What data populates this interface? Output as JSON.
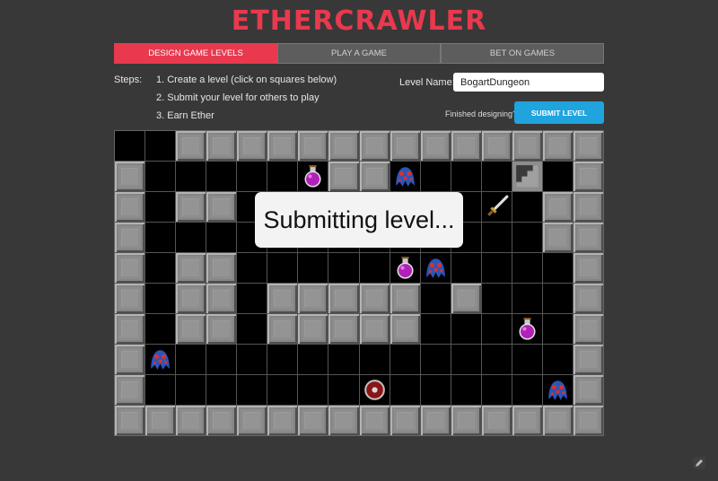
{
  "app": {
    "title": "ETHERCRAWLER"
  },
  "tabs": [
    {
      "label": "DESIGN GAME LEVELS",
      "active": true
    },
    {
      "label": "PLAY A GAME",
      "active": false
    },
    {
      "label": "BET ON GAMES",
      "active": false
    }
  ],
  "steps": {
    "label": "Steps:",
    "items": [
      "1. Create a level (click on squares below)",
      "2. Submit your level for others to play",
      "3. Earn Ether"
    ]
  },
  "level": {
    "name_label": "Level Name:",
    "name_value": "BogartDungeon",
    "finished_text": "Finished designing?",
    "submit_label": "SUBMIT LEVEL"
  },
  "overlay": {
    "message": "Submitting level..."
  },
  "colors": {
    "accent": "#e8394e",
    "button": "#1fa4de",
    "background": "#383838"
  },
  "legend": {
    "W": "wall",
    ".": "floor",
    "P": "potion",
    "M": "monster",
    "S": "stairs",
    "H": "shield",
    "X": "sword"
  },
  "grid": [
    "..WWWWWWWWWWWWWW",
    "W.....PWWM...S.W",
    "W.WW........X.WW",
    "W.............WW",
    "W.WW.....PM....W",
    "W.WW.WWWWW.W...W",
    "W.WW.WWWWW...P.W",
    "WM.............W",
    "W.......H.....MW",
    "WWWWWWWWWWWWWWWW"
  ]
}
